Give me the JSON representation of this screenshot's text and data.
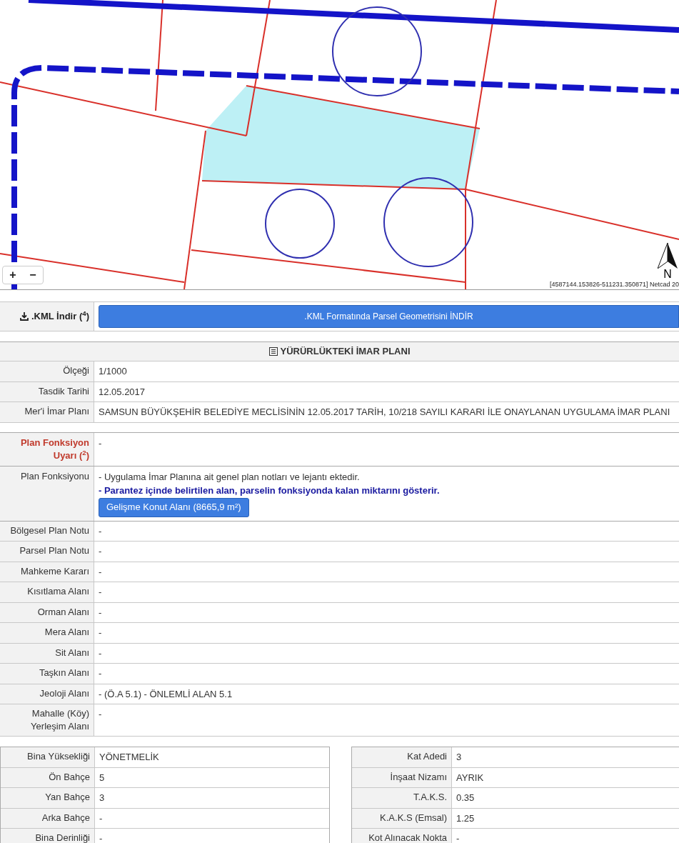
{
  "map": {
    "zoom_in": "+",
    "zoom_out": "−",
    "north": "N",
    "coordinates": "[4587144.153826-511231.350871] Netcad 20"
  },
  "kml": {
    "label": ".KML İndir ($^{4}$)",
    "button": ".KML Formatında Parsel Geometrisini İNDİR"
  },
  "plan": {
    "title": "YÜRÜRLÜKTEKİ İMAR PLANI",
    "rows": [
      {
        "label": "Ölçeği",
        "value": "1/1000"
      },
      {
        "label": "Tasdik Tarihi",
        "value": "12.05.2017"
      },
      {
        "label": "Mer'i İmar Planı",
        "value": "SAMSUN BÜYÜKŞEHİR BELEDİYE MECLİSİNİN 12.05.2017 TARİH, 10/218 SAYILI KARARI İLE ONAYLANAN UYGULAMA İMAR PLANI"
      }
    ],
    "warning": {
      "label": "Plan Fonksiyon Uyarı ($^{2}$)",
      "value": "-"
    },
    "function": {
      "label": "Plan Fonksiyonu",
      "lines": [
        {
          "kind": "text",
          "text": "- Uygulama İmar Planına ait genel plan notları ve lejantı ektedir."
        },
        {
          "kind": "note",
          "text": "- Parantez içinde belirtilen alan, parselin fonksiyonda kalan miktarını gösterir."
        },
        {
          "kind": "tag",
          "text": "Gelişme Konut Alanı (8665,9 m²)"
        }
      ]
    },
    "rows2": [
      {
        "label": "Bölgesel Plan Notu",
        "value": "-"
      },
      {
        "label": "Parsel Plan Notu",
        "value": "-"
      },
      {
        "label": "Mahkeme Kararı",
        "value": "-"
      },
      {
        "label": "Kısıtlama Alanı",
        "value": "-"
      },
      {
        "label": "Orman Alanı",
        "value": "-"
      },
      {
        "label": "Mera Alanı",
        "value": "-"
      },
      {
        "label": "Sit Alanı",
        "value": "-"
      },
      {
        "label": "Taşkın Alanı",
        "value": "-"
      },
      {
        "label": "Jeoloji Alanı",
        "value": "- (Ö.A 5.1) - ÖNLEMLİ ALAN 5.1"
      },
      {
        "label": "Mahalle (Köy) Yerleşim Alanı",
        "value": "-"
      }
    ]
  },
  "details": {
    "left": [
      {
        "label": "Bina Yüksekliği",
        "value": "YÖNETMELİK"
      },
      {
        "label": "Ön Bahçe",
        "value": "5"
      },
      {
        "label": "Yan Bahçe",
        "value": "3"
      },
      {
        "label": "Arka Bahçe",
        "value": "-"
      },
      {
        "label": "Bina Derinliği",
        "value": "-"
      }
    ],
    "right": [
      {
        "label": "Kat Adedi",
        "value": "3"
      },
      {
        "label": "İnşaat Nizamı",
        "value": "AYRIK"
      },
      {
        "label": "T.A.K.S.",
        "value": "0.35"
      },
      {
        "label": "K.A.K.S (Emsal)",
        "value": "1.25"
      },
      {
        "label": "Kot Alınacak Nokta",
        "value": "-"
      }
    ]
  }
}
